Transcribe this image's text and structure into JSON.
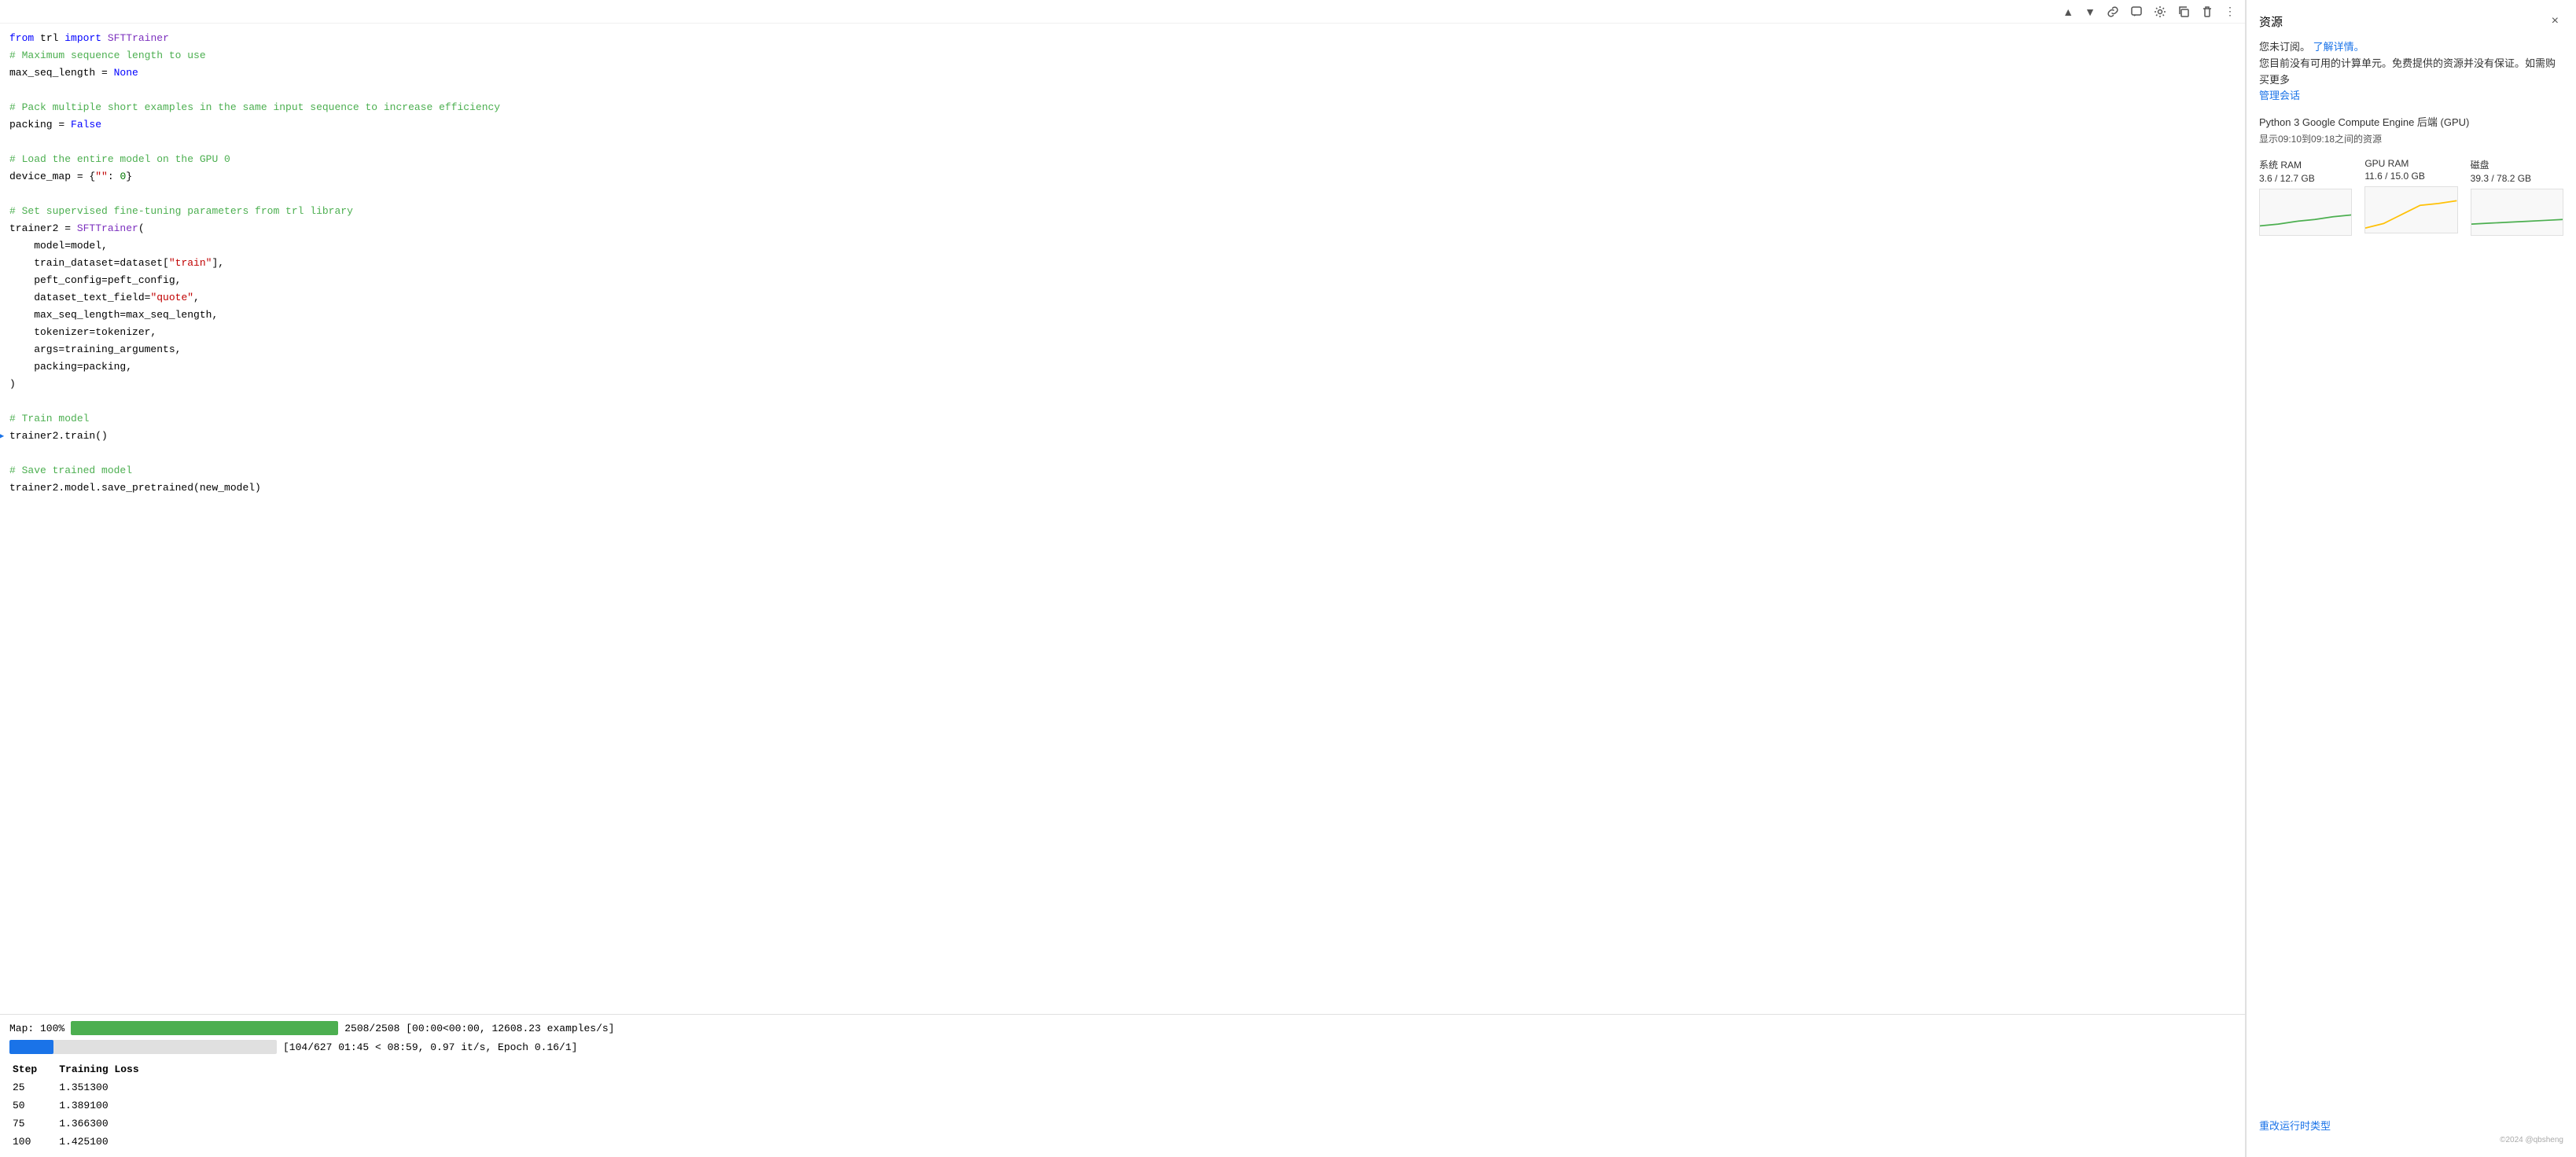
{
  "toolbar": {
    "buttons": [
      {
        "name": "move-up",
        "icon": "▲"
      },
      {
        "name": "move-down",
        "icon": "▼"
      },
      {
        "name": "link",
        "icon": "🔗"
      },
      {
        "name": "comment",
        "icon": "💬"
      },
      {
        "name": "settings",
        "icon": "⚙"
      },
      {
        "name": "copy",
        "icon": "📋"
      },
      {
        "name": "delete",
        "icon": "🗑"
      },
      {
        "name": "more",
        "icon": "⋮"
      }
    ]
  },
  "code": {
    "lines": [
      {
        "id": "l1",
        "text": "from trl import SFTTrainer",
        "type": "mixed"
      },
      {
        "id": "l2",
        "text": "# Maximum sequence length to use",
        "type": "comment"
      },
      {
        "id": "l3",
        "text": "max_seq_length = None",
        "type": "mixed"
      },
      {
        "id": "l4",
        "text": "",
        "type": "empty"
      },
      {
        "id": "l5",
        "text": "# Pack multiple short examples in the same input sequence to increase efficiency",
        "type": "comment"
      },
      {
        "id": "l6",
        "text": "packing = False",
        "type": "mixed"
      },
      {
        "id": "l7",
        "text": "",
        "type": "empty"
      },
      {
        "id": "l8",
        "text": "# Load the entire model on the GPU 0",
        "type": "comment"
      },
      {
        "id": "l9",
        "text": "device_map = {\"\": 0}",
        "type": "mixed"
      },
      {
        "id": "l10",
        "text": "",
        "type": "empty"
      },
      {
        "id": "l11",
        "text": "# Set supervised fine-tuning parameters from trl library",
        "type": "comment"
      },
      {
        "id": "l12",
        "text": "trainer2 = SFTTrainer(",
        "type": "mixed"
      },
      {
        "id": "l13",
        "text": "    model=model,",
        "type": "code"
      },
      {
        "id": "l14",
        "text": "    train_dataset=dataset[\"train\"],",
        "type": "mixed"
      },
      {
        "id": "l15",
        "text": "    peft_config=peft_config,",
        "type": "code"
      },
      {
        "id": "l16",
        "text": "    dataset_text_field=\"quote\",",
        "type": "mixed"
      },
      {
        "id": "l17",
        "text": "    max_seq_length=max_seq_length,",
        "type": "code"
      },
      {
        "id": "l18",
        "text": "    tokenizer=tokenizer,",
        "type": "code"
      },
      {
        "id": "l19",
        "text": "    args=training_arguments,",
        "type": "code"
      },
      {
        "id": "l20",
        "text": "    packing=packing,",
        "type": "code"
      },
      {
        "id": "l21",
        "text": ")",
        "type": "code"
      },
      {
        "id": "l22",
        "text": "",
        "type": "empty"
      },
      {
        "id": "l23",
        "text": "# Train model",
        "type": "comment"
      },
      {
        "id": "l24",
        "text": "trainer2.train()",
        "type": "mixed",
        "executing": true
      },
      {
        "id": "l25",
        "text": "",
        "type": "empty"
      },
      {
        "id": "l26",
        "text": "# Save trained model",
        "type": "comment"
      },
      {
        "id": "l27",
        "text": "trainer2.model.save_pretrained(new_model)",
        "type": "mixed"
      }
    ]
  },
  "output": {
    "progress1": {
      "label": "Map: 100%",
      "percent": 100,
      "stats": "2508/2508 [00:00<00:00, 12608.23 examples/s]"
    },
    "progress2": {
      "label": "",
      "percent": 16.6,
      "stats": "[104/627 01:45 < 08:59, 0.97 it/s, Epoch 0.16/1]"
    },
    "table": {
      "headers": [
        "Step",
        "Training Loss"
      ],
      "rows": [
        {
          "step": "25",
          "loss": "1.351300"
        },
        {
          "step": "50",
          "loss": "1.389100"
        },
        {
          "step": "75",
          "loss": "1.366300"
        },
        {
          "step": "100",
          "loss": "1.425100"
        }
      ]
    }
  },
  "resource_panel": {
    "title": "资源",
    "close_label": "×",
    "subscription_line1": "您未订阅。",
    "subscription_link": "了解详情。",
    "subscription_line2": "您目前没有可用的计算单元。免费提供的资源并没有保证。如需购买更多",
    "subscription_line3": "管理会话",
    "backend": "Python 3 Google Compute Engine 后端 (GPU)",
    "time_range": "显示09:10到09:18之间的资源",
    "metrics": [
      {
        "label": "系统 RAM",
        "value": "3.6 / 12.7 GB",
        "chart_type": "ram",
        "color": "#4caf50"
      },
      {
        "label": "GPU RAM",
        "value": "11.6 / 15.0 GB",
        "chart_type": "gpu",
        "color": "#ffc107"
      },
      {
        "label": "磁盘",
        "value": "39.3 / 78.2 GB",
        "chart_type": "disk",
        "color": "#4caf50"
      }
    ],
    "change_runtime_label": "重改运行时类型",
    "bottom_text": "©2024 @qbsheng"
  }
}
